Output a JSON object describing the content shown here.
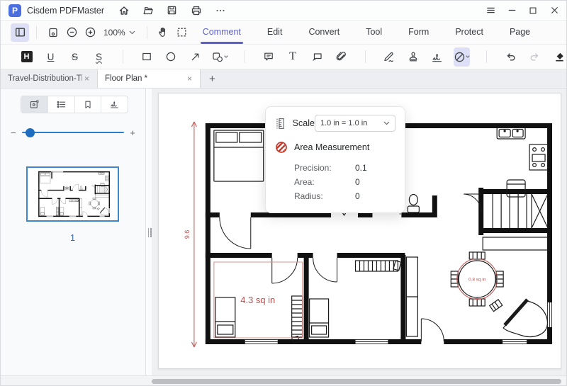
{
  "titlebar": {
    "logo_letter": "P",
    "app_name": "Cisdem PDFMaster"
  },
  "menu": {
    "tabs": [
      {
        "label": "Comment",
        "active": true
      },
      {
        "label": "Edit"
      },
      {
        "label": "Convert"
      },
      {
        "label": "Tool"
      },
      {
        "label": "Form"
      },
      {
        "label": "Protect"
      },
      {
        "label": "Page"
      }
    ]
  },
  "toolbar": {
    "zoom_value": "100%"
  },
  "icons": {
    "highlight": "H",
    "underline": "U",
    "strikethrough": "S",
    "squiggly": "S",
    "text_tool": "T",
    "close_tab": "×",
    "new_tab": "+",
    "slider_zoom_out": "−",
    "slider_zoom_in": "+"
  },
  "document_tabs": {
    "tabs": [
      {
        "label": "Travel-Distribution-Th...",
        "active": false
      },
      {
        "label": "Floor Plan *",
        "active": true
      }
    ]
  },
  "sidebar": {
    "page_number": "1"
  },
  "measure_popup": {
    "scale_label": "Scale",
    "scale_value": "1.0 in = 1.0 in",
    "tool_title": "Area Measurement",
    "fields": [
      {
        "label": "Precision:",
        "value": "0.1"
      },
      {
        "label": "Area:",
        "value": "0"
      },
      {
        "label": "Radius:",
        "value": "0"
      }
    ]
  },
  "floor_plan": {
    "room_area_label": "4.3 sq in",
    "table_area_label": "0.8 sq in",
    "dimension_label": "9.6"
  },
  "colors": {
    "accent_purple": "#5b5fc7",
    "tool_selection_bg": "#dcdff6",
    "slider_blue": "#2b7cd3",
    "thumbnail_border": "#3f87c9",
    "measure_red": "#c0504d",
    "logo_blue": "#4c6fe0"
  }
}
